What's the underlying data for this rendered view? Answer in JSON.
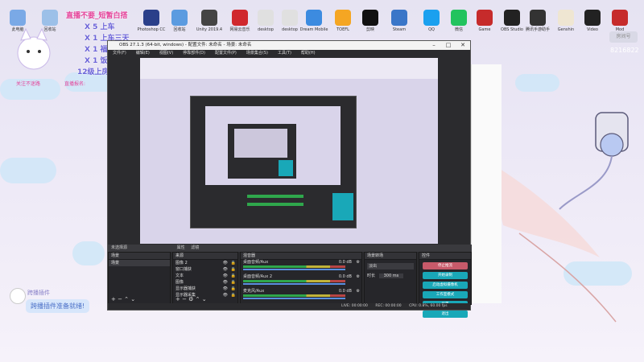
{
  "desktop_icons": [
    {
      "label": "此电脑",
      "color": "#7aa9e6"
    },
    {
      "label": "回收站",
      "color": "#9cc0e8"
    },
    {
      "label": "Photoshop CC",
      "color": "#2a3f8a"
    },
    {
      "label": "回收站",
      "color": "#5b9be0"
    },
    {
      "label": "Unity 2019.4",
      "color": "#444"
    },
    {
      "label": "网易云音乐",
      "color": "#d0282d"
    },
    {
      "label": "desktop",
      "color": "#e0e0e0"
    },
    {
      "label": "desktop",
      "color": "#e0e0e0"
    },
    {
      "label": "Dream Mobile",
      "color": "#3c8be0"
    },
    {
      "label": "TOEFL",
      "color": "#f5a623"
    },
    {
      "label": "剪映",
      "color": "#111"
    },
    {
      "label": "Steam",
      "color": "#3a76c8"
    },
    {
      "label": "QQ",
      "color": "#1aa0ef"
    },
    {
      "label": "微信",
      "color": "#22c35e"
    },
    {
      "label": "Game",
      "color": "#c62b2b"
    },
    {
      "label": "OBS Studio",
      "color": "#222"
    },
    {
      "label": "腾讯手游助手",
      "color": "#333"
    },
    {
      "label": "Genshin",
      "color": "#efe6d2"
    },
    {
      "label": "Video",
      "color": "#222"
    },
    {
      "label": "Mod",
      "color": "#c62b2b"
    }
  ],
  "overlay": {
    "line1": "直播不要_短暂白搭",
    "line2": "X 5 上车",
    "line3": "X 1 上车三天",
    "line4": "X 1 福利",
    "line5": "X 1 饭",
    "line6": "12级上房管",
    "caption_left": "关注不迷路",
    "caption_right": "直播报名:"
  },
  "badge": {
    "text": "房间号",
    "id": "8216822"
  },
  "chat": {
    "user": "跨播插件",
    "message": "跨播插件准备就绪!"
  },
  "obs": {
    "title": "OBS 27.1.3 (64-bit, windows) - 配置文件: 未命名 - 场景: 未命名",
    "menu": [
      "文件(F)",
      "编辑(E)",
      "视图(V)",
      "停靠部件(D)",
      "配置文件(P)",
      "场景集合(S)",
      "工具(T)",
      "帮助(H)"
    ],
    "panels": {
      "scenes_header": "场景",
      "sources_header": "来源",
      "mixer_header": "混音器",
      "transitions_header": "场景转场",
      "controls_header": "控件",
      "scene_tab": "未选择源",
      "props_tab": "属性",
      "filters_tab": "滤镜"
    },
    "scenes": [
      "场景"
    ],
    "sources": [
      "图像 2",
      "窗口捕获",
      "文本",
      "图像",
      "显示器捕获",
      "显示器采集"
    ],
    "mixer": [
      {
        "name": "桌面音频/Aux",
        "db": "0.0 dB"
      },
      {
        "name": "桌面音频/Aux 2",
        "db": "0.0 dB"
      },
      {
        "name": "麦克风/Aux",
        "db": "0.0 dB"
      }
    ],
    "transition": {
      "type": "淡出",
      "duration_label": "时长",
      "duration": "300 ms"
    },
    "controls": [
      "停止推流",
      "开始录制",
      "启动虚拟摄像机",
      "工作室模式",
      "设置",
      "退出"
    ],
    "status": {
      "live": "LIVE: 00:00:00",
      "rec": "REC: 00:00:00",
      "cpu": "CPU: 0.8%, 60.00 fps"
    }
  },
  "colors": {
    "obs_bg": "#2b2b2e",
    "control_btn": "#19a8b8",
    "overlay_text": "#6b63d8"
  }
}
